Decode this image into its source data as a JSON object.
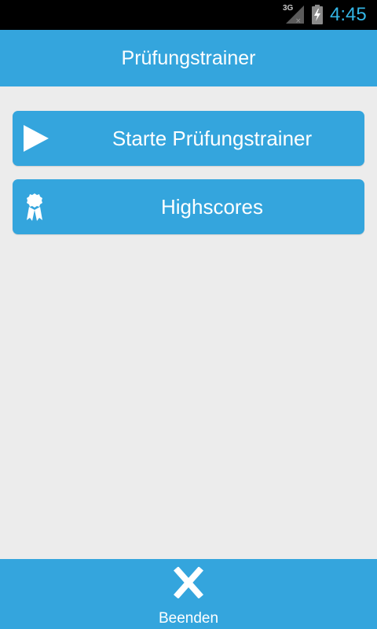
{
  "status_bar": {
    "network_type": "3G",
    "time": "4:45",
    "icons": [
      "signal-icon",
      "battery-charging-icon"
    ],
    "clock_color": "#33b5e5"
  },
  "app_bar": {
    "title": "Prüfungstrainer"
  },
  "menu": {
    "start_label": "Starte Prüfungstrainer",
    "start_icon": "play-icon",
    "highscores_label": "Highscores",
    "highscores_icon": "award-ribbon-icon"
  },
  "footer": {
    "exit_label": "Beenden",
    "exit_icon": "close-icon"
  },
  "colors": {
    "accent": "#34a5dd",
    "background": "#ececec",
    "status_bar": "#000000",
    "text_on_accent": "#ffffff"
  }
}
